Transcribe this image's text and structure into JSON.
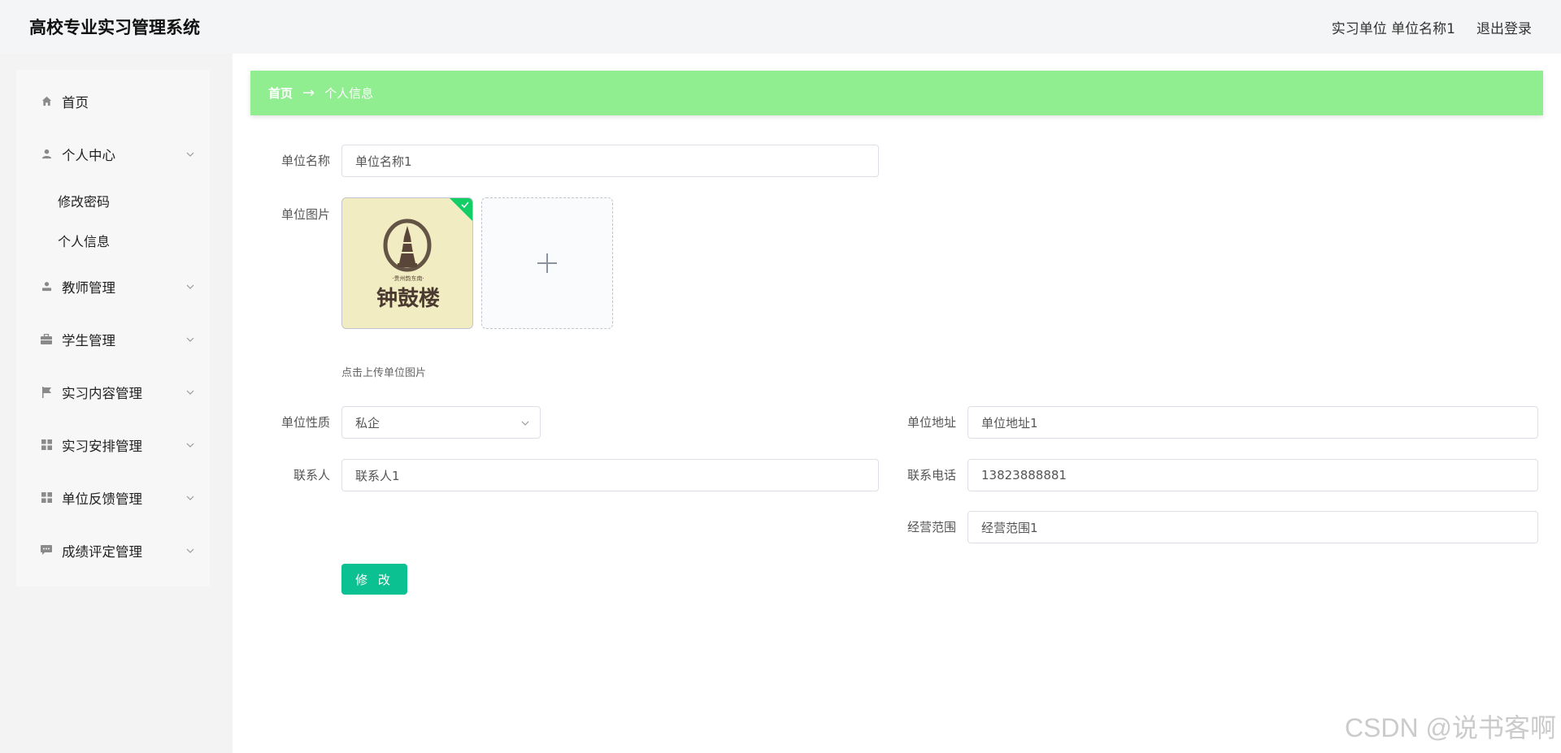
{
  "header": {
    "app_title": "高校专业实习管理系统",
    "user_info": "实习单位 单位名称1",
    "logout_label": "退出登录"
  },
  "sidebar": {
    "items": [
      {
        "label": "首页",
        "icon": "home-icon"
      },
      {
        "label": "个人中心",
        "icon": "user-icon",
        "expanded": true,
        "children": [
          "修改密码",
          "个人信息"
        ]
      },
      {
        "label": "教师管理",
        "icon": "teacher-icon"
      },
      {
        "label": "学生管理",
        "icon": "briefcase-icon"
      },
      {
        "label": "实习内容管理",
        "icon": "flag-icon"
      },
      {
        "label": "实习安排管理",
        "icon": "grid-icon"
      },
      {
        "label": "单位反馈管理",
        "icon": "grid-icon"
      },
      {
        "label": "成绩评定管理",
        "icon": "chat-icon"
      }
    ]
  },
  "breadcrumb": {
    "home": "首页",
    "arrow": "→",
    "current": "个人信息"
  },
  "form": {
    "name_label": "单位名称",
    "name_value": "单位名称1",
    "image_label": "单位图片",
    "image_text_line1": "·贵州韵东南·",
    "image_text_line2": "钟鼓楼",
    "upload_tip": "点击上传单位图片",
    "nature_label": "单位性质",
    "nature_value": "私企",
    "address_label": "单位地址",
    "address_value": "单位地址1",
    "contact_label": "联系人",
    "contact_value": "联系人1",
    "phone_label": "联系电话",
    "phone_value": "13823888881",
    "scope_label": "经营范围",
    "scope_value": "经营范围1",
    "submit_label": "修 改"
  },
  "watermark": "CSDN @说书客啊",
  "colors": {
    "breadcrumb_bg": "#90ee90",
    "submit_bg": "#0cc191",
    "upload_success": "#13ce66"
  }
}
